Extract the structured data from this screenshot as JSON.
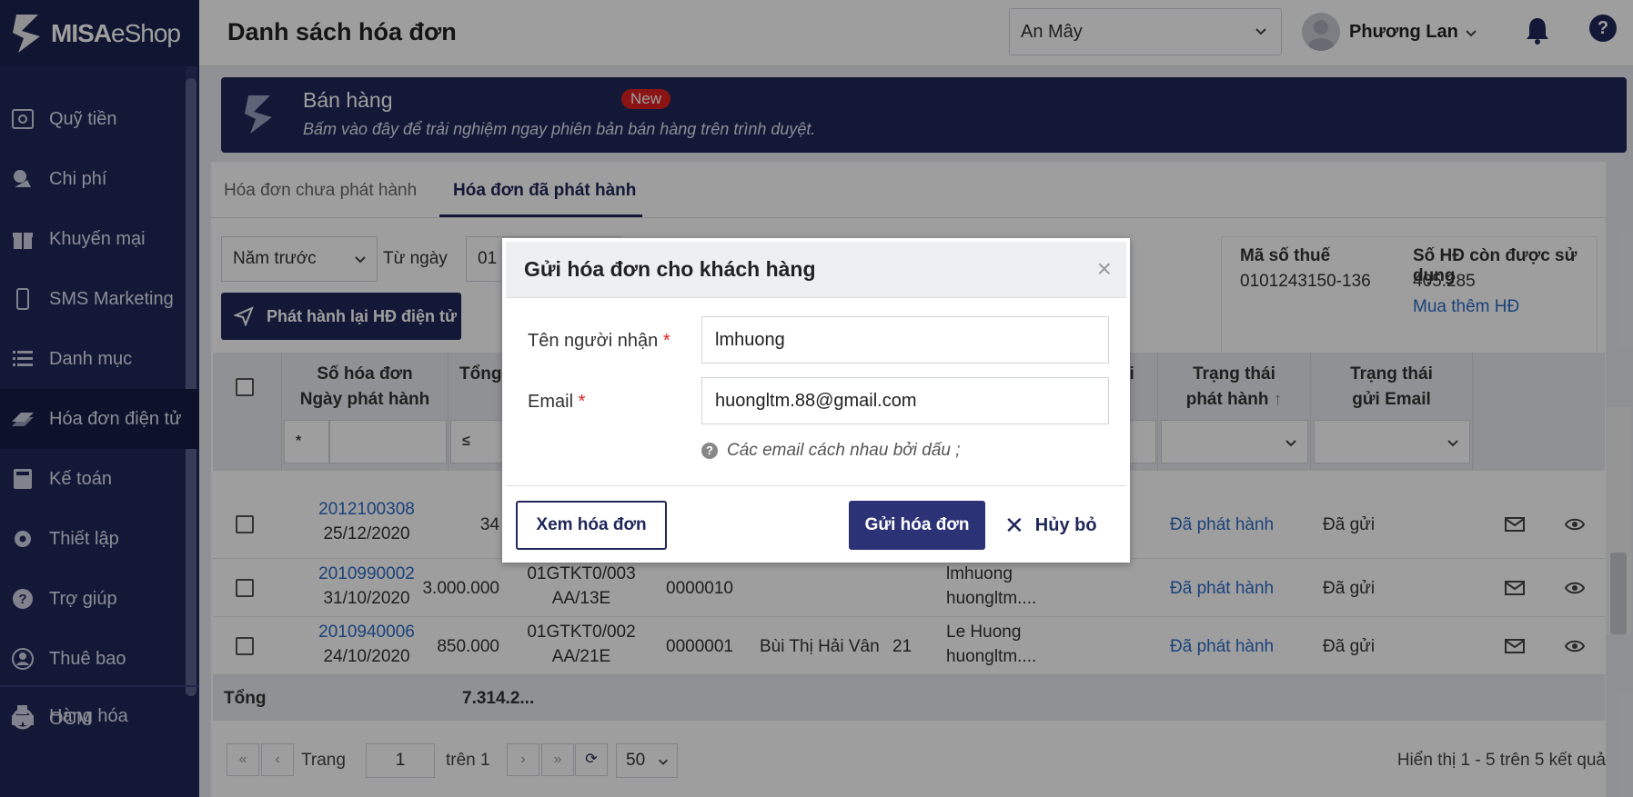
{
  "app": {
    "brand_bold": "MISA",
    "brand_light": "eShop"
  },
  "sidebar": {
    "items": [
      {
        "label": "Quỹ tiền",
        "icon": "safe-icon"
      },
      {
        "label": "Chi phí",
        "icon": "expense-icon"
      },
      {
        "label": "Khuyến mại",
        "icon": "gift-icon"
      },
      {
        "label": "SMS Marketing",
        "icon": "phone-icon"
      },
      {
        "label": "Danh mục",
        "icon": "list-icon"
      },
      {
        "label": "Hóa đơn điện tử",
        "icon": "invoice-icon",
        "active": true
      },
      {
        "label": "Kế toán",
        "icon": "calculator-icon"
      },
      {
        "label": "Thiết lập",
        "icon": "gear-icon"
      },
      {
        "label": "Trợ giúp",
        "icon": "question-icon"
      },
      {
        "label": "Thuê bao",
        "icon": "user-icon"
      },
      {
        "label": "OCM",
        "icon": "ocm-icon"
      }
    ],
    "bottom_item": {
      "label": "Hàng hóa",
      "icon": "boxes-icon"
    }
  },
  "header": {
    "title": "Danh sách hóa đơn",
    "store": "An Mây",
    "user": "Phương Lan",
    "help": "?"
  },
  "banner": {
    "title": "Bán hàng",
    "badge": "New",
    "subtitle": "Bấm vào đây để trải nghiệm ngay phiên bản bán hàng trên trình duyệt."
  },
  "tabs": [
    {
      "label": "Hóa đơn chưa phát hành",
      "active": false
    },
    {
      "label": "Hóa đơn đã phát hành",
      "active": true
    }
  ],
  "filter": {
    "period": "Năm trước",
    "from_label": "Từ ngày",
    "from_value": "01",
    "reissue_button": "Phát hành lại HĐ điện tử"
  },
  "tax_info": {
    "tax_label": "Mã số thuế",
    "tax_value": "0101243150-136",
    "remaining_label": "Số HĐ còn được sử dụng",
    "remaining_value": "405.285",
    "buy_link": "Mua thêm HĐ"
  },
  "table": {
    "headers": {
      "invoice": "Số hóa đơn",
      "issue_date": "Ngày phát hành",
      "total": "Tổng",
      "buyer_fragment": "ời",
      "status_issue_1": "Trạng thái",
      "status_issue_2": "phát hành",
      "status_email_1": "Trạng thái",
      "status_email_2": "gửi Email",
      "filter_star": "*",
      "filter_le": "≤"
    },
    "rows": [
      {
        "invoice": "2012100308",
        "date": "25/12/2020",
        "amount": "34",
        "template": "",
        "serial": "",
        "number": "",
        "customer": "",
        "qty": "",
        "buyer": "",
        "buyer_email": "...",
        "issue_status": "Đã phát hành",
        "email_status": "Đã gửi"
      },
      {
        "invoice": "2010990002",
        "date": "31/10/2020",
        "amount": "3.000.000",
        "template": "01GTKT0/003",
        "serial": "AA/13E",
        "number": "0000010",
        "customer": "",
        "qty": "",
        "buyer": "lmhuong",
        "buyer_email": "huongltm....",
        "issue_status": "Đã phát hành",
        "email_status": "Đã gửi"
      },
      {
        "invoice": "2010940006",
        "date": "24/10/2020",
        "amount": "850.000",
        "template": "01GTKT0/002",
        "serial": "AA/21E",
        "number": "0000001",
        "customer": "Bùi Thị Hải Vân",
        "qty": "21",
        "buyer": "Le Huong",
        "buyer_email": "huongltm....",
        "issue_status": "Đã phát hành",
        "email_status": "Đã gửi"
      }
    ],
    "total_label": "Tổng",
    "total_value": "7.314.2..."
  },
  "pager": {
    "page_label": "Trang",
    "page_value": "1",
    "of_label": "trên 1",
    "page_size": "50",
    "result": "Hiển thị 1 - 5 trên 5 kết quả"
  },
  "modal": {
    "title": "Gửi hóa đơn cho khách hàng",
    "recipient_label": "Tên người nhận",
    "recipient_value": "lmhuong",
    "email_label": "Email",
    "email_value": "huongltm.88@gmail.com",
    "hint": "Các email cách nhau bởi dấu ;",
    "required_mark": "*",
    "view_button": "Xem hóa đơn",
    "send_button": "Gửi hóa đơn",
    "cancel_button": "Hủy bỏ"
  },
  "colors": {
    "navy": "#20285a",
    "link": "#2c6bc8",
    "badge_red": "#e02020"
  }
}
